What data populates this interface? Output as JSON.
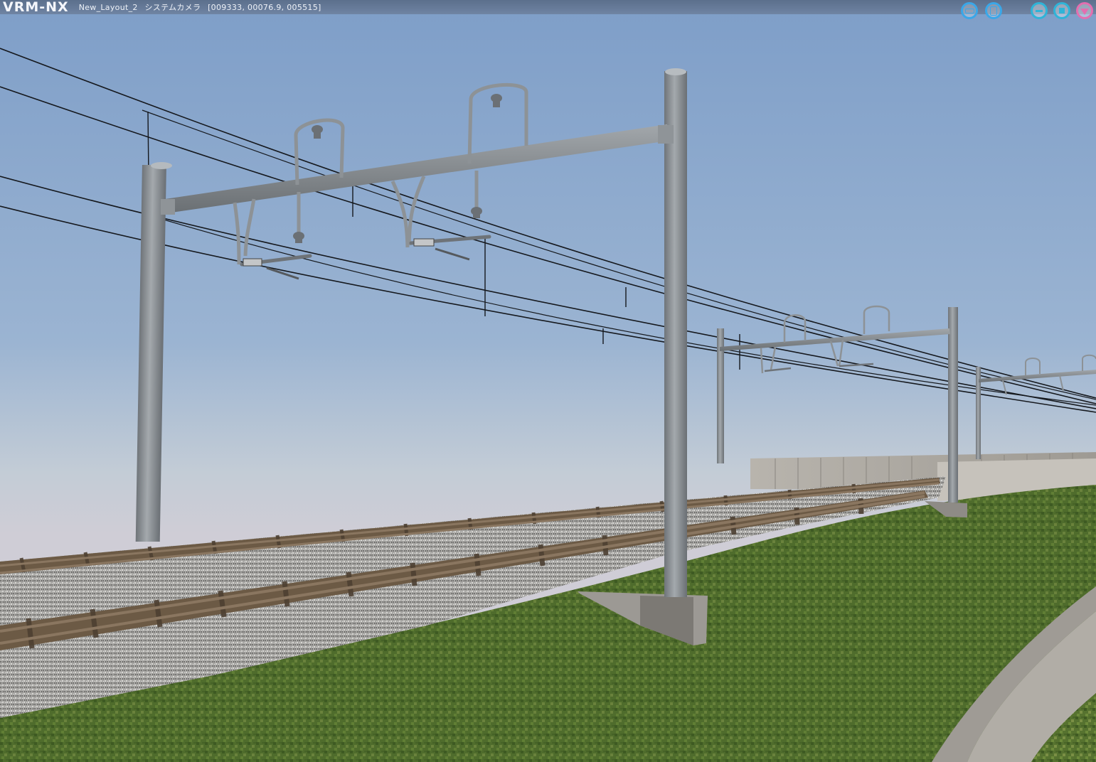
{
  "app": {
    "logo": "VRM-NX",
    "layout_name": "New_Layout_2",
    "camera_label": "システムカメラ",
    "coordinates": "[009333, 00076.9, 005515]"
  },
  "window_controls": {
    "left_group": [
      "minimize-alt-icon",
      "maximize-alt-icon"
    ],
    "right_group": [
      "minimize-icon",
      "stop-icon",
      "menu-triangle-icon"
    ]
  },
  "scene": {
    "description_objects": [
      "sky",
      "catenary-poles",
      "overhead-wires",
      "double-track",
      "ballast",
      "embankment-grass",
      "concrete-wall",
      "curved-concrete-wall"
    ],
    "colors": {
      "sky_top": "#7f9fc9",
      "sky_bottom": "#c9c9d3",
      "pole": "#8e9397",
      "wire": "#1a1d22",
      "rail": "#6a5a48",
      "ballast": "#9a9a9a",
      "grass": "#4f6a2c",
      "concrete": "#a7a39c"
    }
  }
}
